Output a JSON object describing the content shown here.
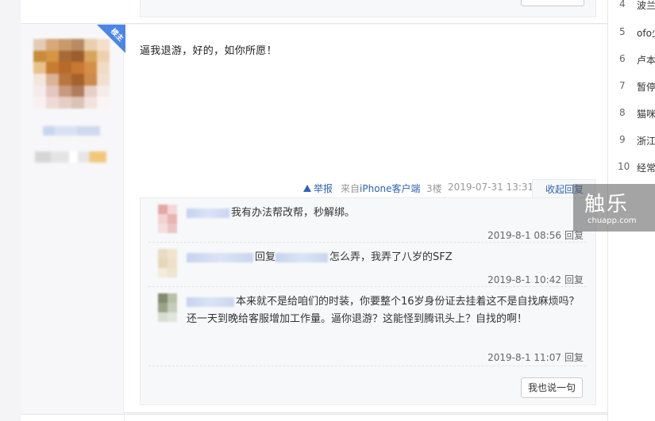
{
  "post": {
    "content": "逼我退游，好的，如你所愿！",
    "louzhu_badge": "楼主",
    "tail": {
      "report": "举报",
      "from_prefix": "来自",
      "device": "iPhone客户端",
      "floor": "3楼",
      "time": "2019-07-31 13:31",
      "collapse": "收起回复"
    }
  },
  "replies": [
    {
      "text": "我有办法帮改帮，秒解绑。",
      "time": "2019-8-1 08:56",
      "reply_label": "回复"
    },
    {
      "prefix": "回复",
      "text": "怎么弄，我弄了八岁的SFZ",
      "time": "2019-8-1 10:42",
      "reply_label": "回复"
    },
    {
      "text": "本来就不是给咱们的时装，你要整个16岁身份证去挂着这不是自找麻烦吗？还一天到晚给客服增加工作量。逼你退游？这能怪到腾讯头上？自找的啊！",
      "time": "2019-8-1 11:07",
      "reply_label": "回复"
    }
  ],
  "say_button": "我也说一句",
  "sidebar": {
    "items": [
      {
        "num": "4",
        "title": "波兰"
      },
      {
        "num": "5",
        "title": "ofo少"
      },
      {
        "num": "6",
        "title": "卢本"
      },
      {
        "num": "7",
        "title": "暂停"
      },
      {
        "num": "8",
        "title": "猫咪"
      },
      {
        "num": "9",
        "title": "浙江"
      },
      {
        "num": "10",
        "title": "经常"
      }
    ]
  },
  "watermark": {
    "cn": "触乐",
    "en": "chuapp.com"
  },
  "colors": {
    "link": "#2d64b3",
    "louzhu_badge": "#4a86e8",
    "lzl_bg": "#f7f8fa"
  }
}
